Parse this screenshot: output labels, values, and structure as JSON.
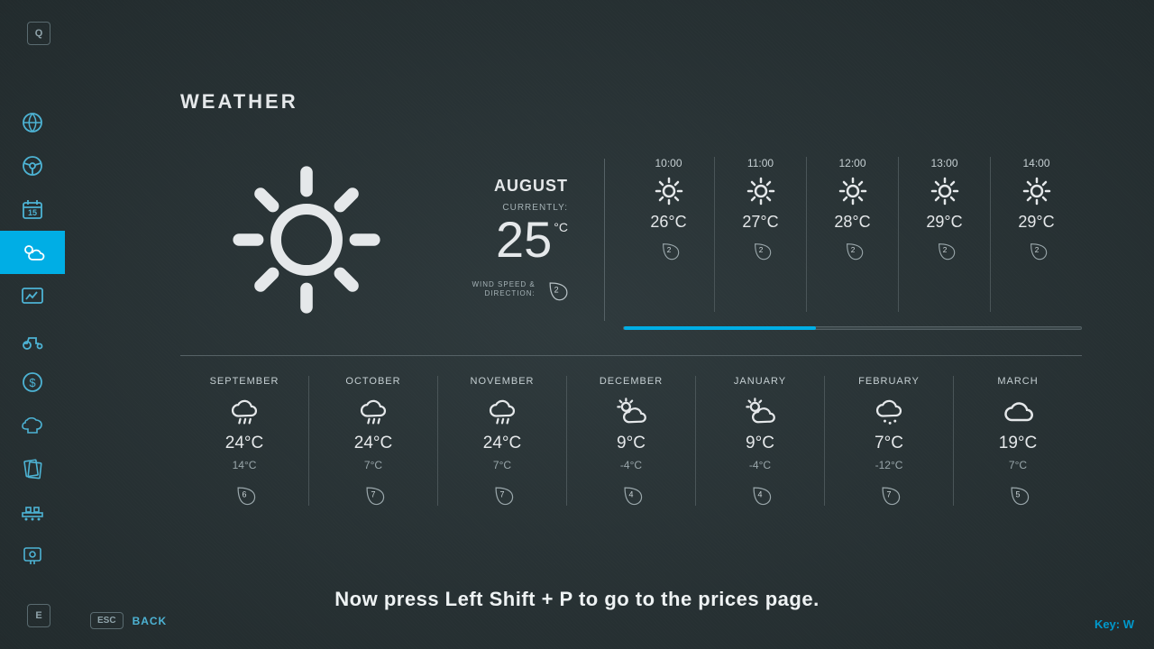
{
  "topKey": "Q",
  "bottomKey": "E",
  "sidebar": {
    "items": [
      {
        "name": "map",
        "active": false
      },
      {
        "name": "drive",
        "active": false
      },
      {
        "name": "calendar",
        "active": false
      },
      {
        "name": "weather",
        "active": true
      },
      {
        "name": "stats",
        "active": false
      },
      {
        "name": "vehicles",
        "active": false
      },
      {
        "name": "finance",
        "active": false
      },
      {
        "name": "animals",
        "active": false
      },
      {
        "name": "contracts",
        "active": false
      },
      {
        "name": "production",
        "active": false
      },
      {
        "name": "help",
        "active": false
      }
    ]
  },
  "pageTitle": "WEATHER",
  "current": {
    "month": "AUGUST",
    "currentlyLabel": "CURRENTLY:",
    "temp": "25",
    "unit": "°C",
    "windLabel": "WIND SPEED &\nDIRECTION:",
    "windValue": "2"
  },
  "hourly": [
    {
      "time": "10:00",
      "icon": "sun",
      "temp": "26°C",
      "wind": "2"
    },
    {
      "time": "11:00",
      "icon": "sun",
      "temp": "27°C",
      "wind": "2"
    },
    {
      "time": "12:00",
      "icon": "sun",
      "temp": "28°C",
      "wind": "2"
    },
    {
      "time": "13:00",
      "icon": "sun",
      "temp": "29°C",
      "wind": "2"
    },
    {
      "time": "14:00",
      "icon": "sun",
      "temp": "29°C",
      "wind": "2"
    }
  ],
  "monthly": [
    {
      "name": "SEPTEMBER",
      "icon": "rain",
      "hi": "24°C",
      "lo": "14°C",
      "wind": "6"
    },
    {
      "name": "OCTOBER",
      "icon": "rain",
      "hi": "24°C",
      "lo": "7°C",
      "wind": "7"
    },
    {
      "name": "NOVEMBER",
      "icon": "rain",
      "hi": "24°C",
      "lo": "7°C",
      "wind": "7"
    },
    {
      "name": "DECEMBER",
      "icon": "partly",
      "hi": "9°C",
      "lo": "-4°C",
      "wind": "4"
    },
    {
      "name": "JANUARY",
      "icon": "partly",
      "hi": "9°C",
      "lo": "-4°C",
      "wind": "4"
    },
    {
      "name": "FEBRUARY",
      "icon": "snow",
      "hi": "7°C",
      "lo": "-12°C",
      "wind": "7"
    },
    {
      "name": "MARCH",
      "icon": "cloud",
      "hi": "19°C",
      "lo": "7°C",
      "wind": "5"
    }
  ],
  "hint": "Now press Left Shift + P to go to the prices page.",
  "back": {
    "key": "ESC",
    "label": "BACK"
  },
  "keyIndicator": "Key: W"
}
